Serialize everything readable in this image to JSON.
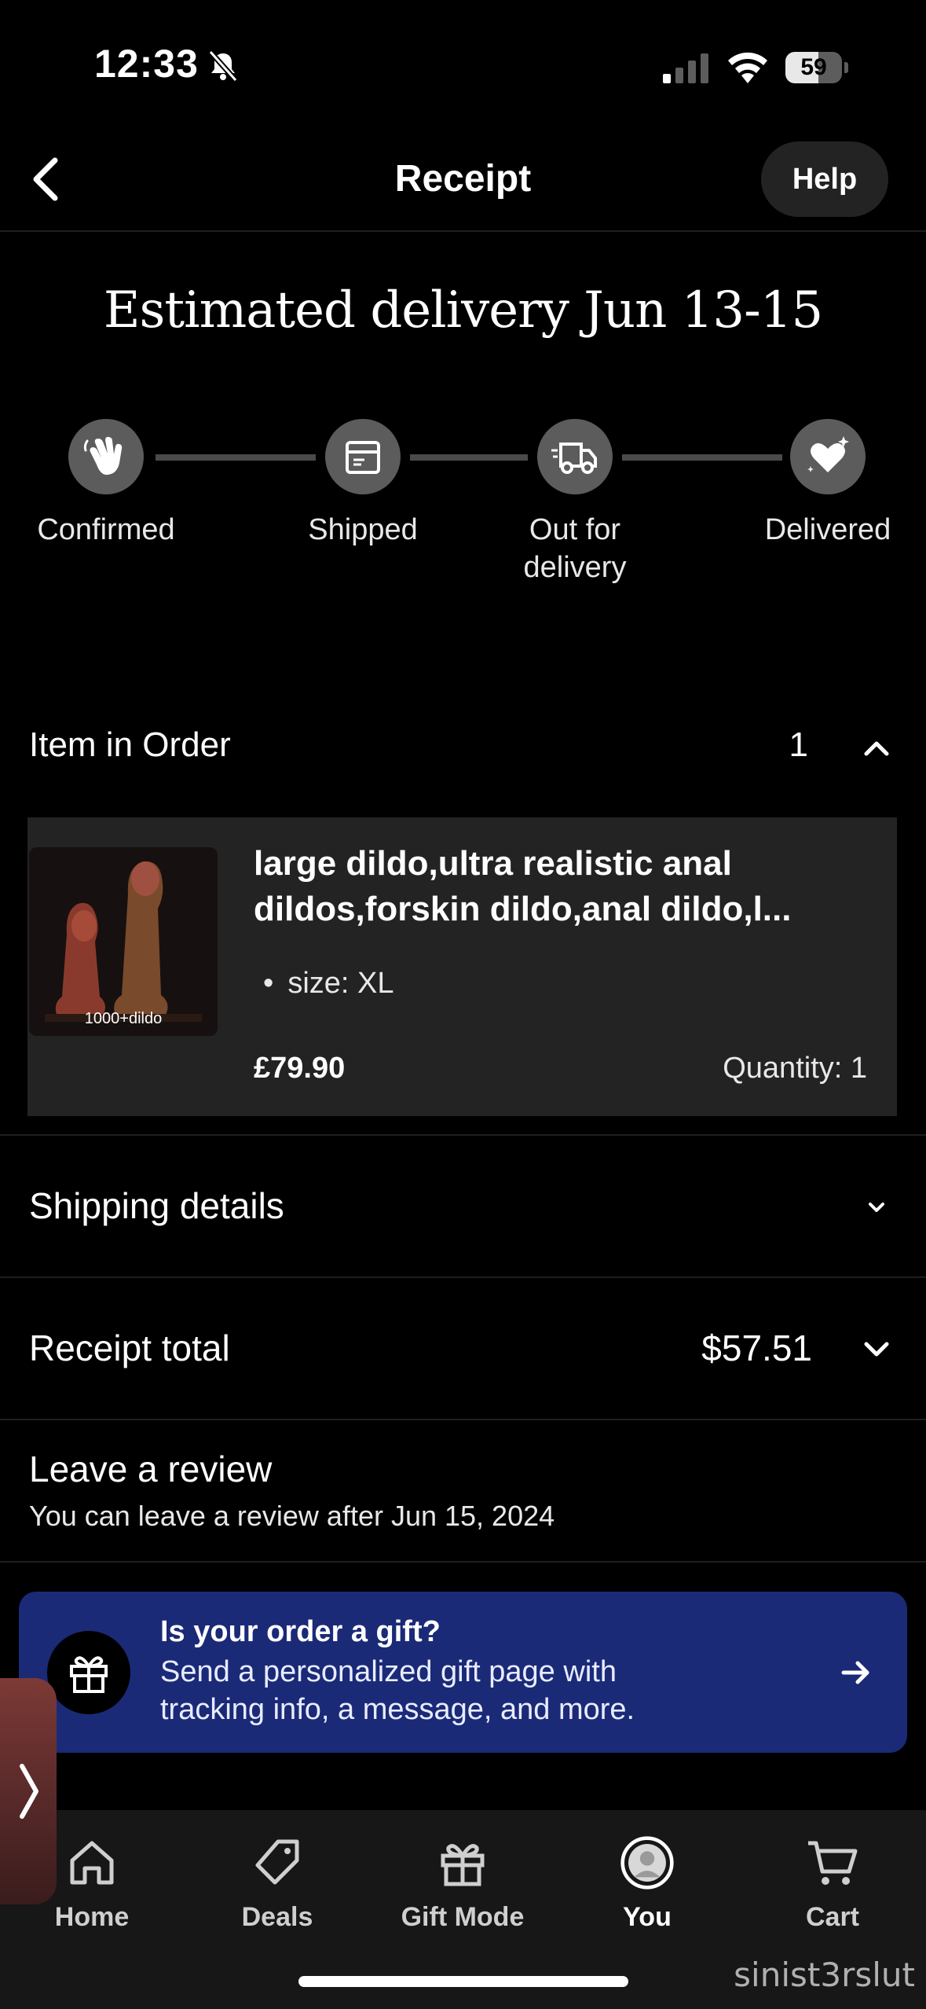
{
  "status_bar": {
    "time": "12:33",
    "battery": "59",
    "battery_level": 0.59
  },
  "header": {
    "title": "Receipt",
    "help_label": "Help"
  },
  "delivery": {
    "title": "Estimated delivery Jun 13-15",
    "steps": [
      {
        "label": "Confirmed",
        "icon": "hand-wave-icon"
      },
      {
        "label": "Shipped",
        "icon": "package-icon"
      },
      {
        "label": "Out for delivery",
        "icon": "delivery-truck-icon"
      },
      {
        "label": "Delivered",
        "icon": "heart-sparkle-icon"
      }
    ]
  },
  "order": {
    "section_label": "Item in Order",
    "count": "1",
    "item": {
      "title": "large dildo,ultra realistic anal dildos,forskin dildo,anal dildo,l...",
      "thumb_caption": "1000+dildo",
      "attribute": "size: XL",
      "price": "£79.90",
      "quantity": "Quantity: 1"
    }
  },
  "shipping": {
    "label": "Shipping details"
  },
  "receipt_total": {
    "label": "Receipt total",
    "value": "$57.51"
  },
  "review": {
    "title": "Leave a review",
    "subtitle": "You can leave a review after Jun 15, 2024"
  },
  "gift": {
    "title": "Is your order a gift?",
    "body": "Send a personalized gift page with tracking info, a message, and more."
  },
  "tabs": [
    {
      "label": "Home",
      "icon": "home-icon"
    },
    {
      "label": "Deals",
      "icon": "tag-icon"
    },
    {
      "label": "Gift Mode",
      "icon": "gift-icon"
    },
    {
      "label": "You",
      "icon": "avatar-icon",
      "active": true
    },
    {
      "label": "Cart",
      "icon": "cart-icon"
    }
  ],
  "watermark": "sinist3rslut",
  "colors": {
    "background": "#000000",
    "card": "#232323",
    "gift_banner": "#1b2a77",
    "step_icon": "#5c5c5c"
  }
}
